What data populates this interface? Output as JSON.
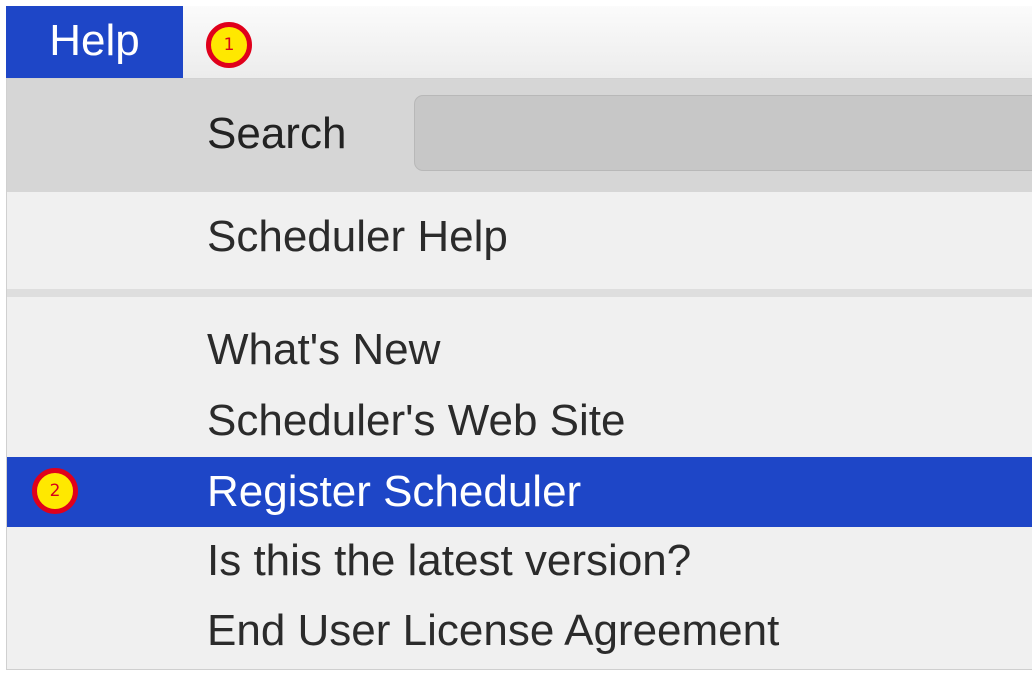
{
  "menubar": {
    "help_label": "Help"
  },
  "callouts": {
    "first": "1",
    "second": "2"
  },
  "menu": {
    "search_label": "Search",
    "items": [
      {
        "label": "Scheduler Help"
      },
      {
        "label": "What's New"
      },
      {
        "label": "Scheduler's Web Site"
      },
      {
        "label": "Register Scheduler",
        "highlighted": true
      },
      {
        "label": "Is this the latest version?"
      },
      {
        "label": "End User License Agreement"
      }
    ]
  },
  "colors": {
    "highlight": "#1e46c7",
    "menu_background": "#f0f0f0",
    "search_row_background": "#d6d6d6",
    "callout_fill": "#ffe800",
    "callout_ring": "#e0001b"
  }
}
